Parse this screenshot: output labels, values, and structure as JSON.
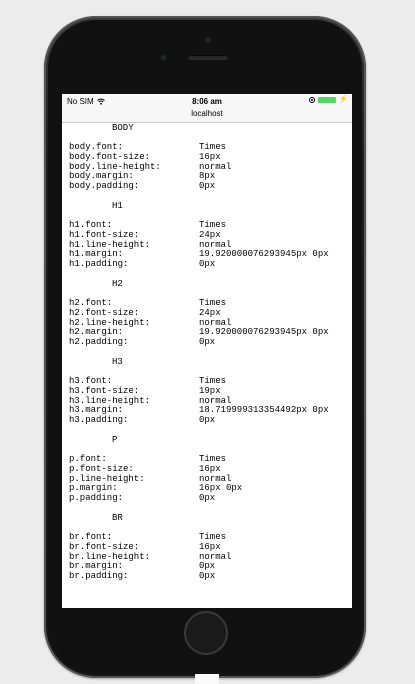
{
  "status": {
    "carrier": "No SIM",
    "time": "8:06 am"
  },
  "browser": {
    "url": "localhost"
  },
  "sections": [
    {
      "heading": "BODY",
      "rows": [
        {
          "name": "body.font:",
          "value": "Times"
        },
        {
          "name": "body.font-size:",
          "value": "16px"
        },
        {
          "name": "body.line-height:",
          "value": "normal"
        },
        {
          "name": "body.margin:",
          "value": "8px"
        },
        {
          "name": "body.padding:",
          "value": "0px"
        }
      ]
    },
    {
      "heading": "H1",
      "rows": [
        {
          "name": "h1.font:",
          "value": "Times"
        },
        {
          "name": "h1.font-size:",
          "value": "24px"
        },
        {
          "name": "h1.line-height:",
          "value": "normal"
        },
        {
          "name": "h1.margin:",
          "value": "19.920000076293945px 0px"
        },
        {
          "name": "h1.padding:",
          "value": "0px"
        }
      ]
    },
    {
      "heading": "H2",
      "rows": [
        {
          "name": "h2.font:",
          "value": "Times"
        },
        {
          "name": "h2.font-size:",
          "value": "24px"
        },
        {
          "name": "h2.line-height:",
          "value": "normal"
        },
        {
          "name": "h2.margin:",
          "value": "19.920000076293945px 0px"
        },
        {
          "name": "h2.padding:",
          "value": "0px"
        }
      ]
    },
    {
      "heading": "H3",
      "rows": [
        {
          "name": "h3.font:",
          "value": "Times"
        },
        {
          "name": "h3.font-size:",
          "value": "19px"
        },
        {
          "name": "h3.line-height:",
          "value": "normal"
        },
        {
          "name": "h3.margin:",
          "value": "18.719999313354492px 0px"
        },
        {
          "name": "h3.padding:",
          "value": "0px"
        }
      ]
    },
    {
      "heading": "P",
      "rows": [
        {
          "name": "p.font:",
          "value": "Times"
        },
        {
          "name": "p.font-size:",
          "value": "16px"
        },
        {
          "name": "p.line-height:",
          "value": "normal"
        },
        {
          "name": "p.margin:",
          "value": "16px 0px"
        },
        {
          "name": "p.padding:",
          "value": "0px"
        }
      ]
    },
    {
      "heading": "BR",
      "rows": [
        {
          "name": "br.font:",
          "value": "Times"
        },
        {
          "name": "br.font-size:",
          "value": "16px"
        },
        {
          "name": "br.line-height:",
          "value": "normal"
        },
        {
          "name": "br.margin:",
          "value": "0px"
        },
        {
          "name": "br.padding:",
          "value": "0px"
        }
      ]
    }
  ],
  "icons": {
    "wifi": "wifi-icon",
    "lock": "orientation-lock-icon",
    "battery": "battery-icon",
    "charging": "charging-bolt-icon"
  },
  "colors": {
    "battery": "#4cd964",
    "phone_body": "#1a1a1a",
    "page_background": "#ececec"
  }
}
